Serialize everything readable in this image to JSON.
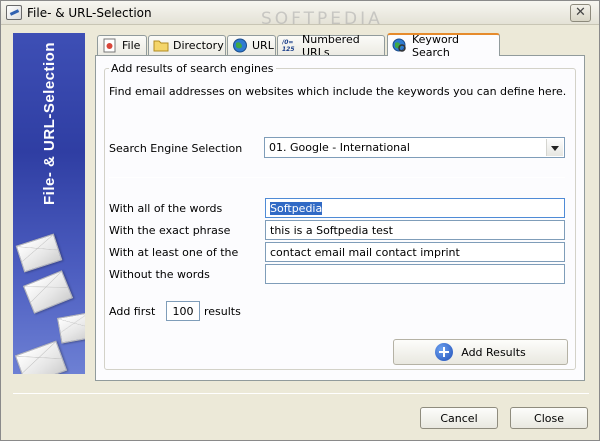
{
  "window": {
    "title": "File- & URL-Selection",
    "close_glyph": "✕"
  },
  "watermark": "SOFTPEDIA",
  "sidebar": {
    "title": "File- & URL-Selection"
  },
  "tabs": [
    {
      "label": "File",
      "icon": "file-icon"
    },
    {
      "label": "Directory",
      "icon": "folder-icon"
    },
    {
      "label": "URL",
      "icon": "globe-icon"
    },
    {
      "label": "Numbered URLs",
      "icon": "numbered-urls-icon",
      "icon_text": "/0=\n125"
    },
    {
      "label": "Keyword Search",
      "icon": "search-globe-icon",
      "active": true
    }
  ],
  "panel": {
    "group_title": "Add results of search engines",
    "description": "Find email addresses on websites which include the keywords you can define here.",
    "engine_label": "Search Engine Selection",
    "engine_value": "01. Google - International",
    "fields": {
      "all_words_label": "With all of the words",
      "all_words_value": "Softpedia",
      "exact_phrase_label": "With the exact phrase",
      "exact_phrase_value": "this is a Softpedia test",
      "at_least_one_label": "With at least one of the",
      "at_least_one_value": "contact email mail contact imprint",
      "without_label": "Without the words",
      "without_value": ""
    },
    "add_first_label": "Add first",
    "add_first_value": "100",
    "results_label": "results",
    "add_results_label": "Add Results"
  },
  "buttons": {
    "cancel": "Cancel",
    "close": "Close"
  },
  "colors": {
    "sidebar": "#3e4fb5",
    "active_tab_accent": "#e68b2c",
    "selection": "#316ac5"
  }
}
